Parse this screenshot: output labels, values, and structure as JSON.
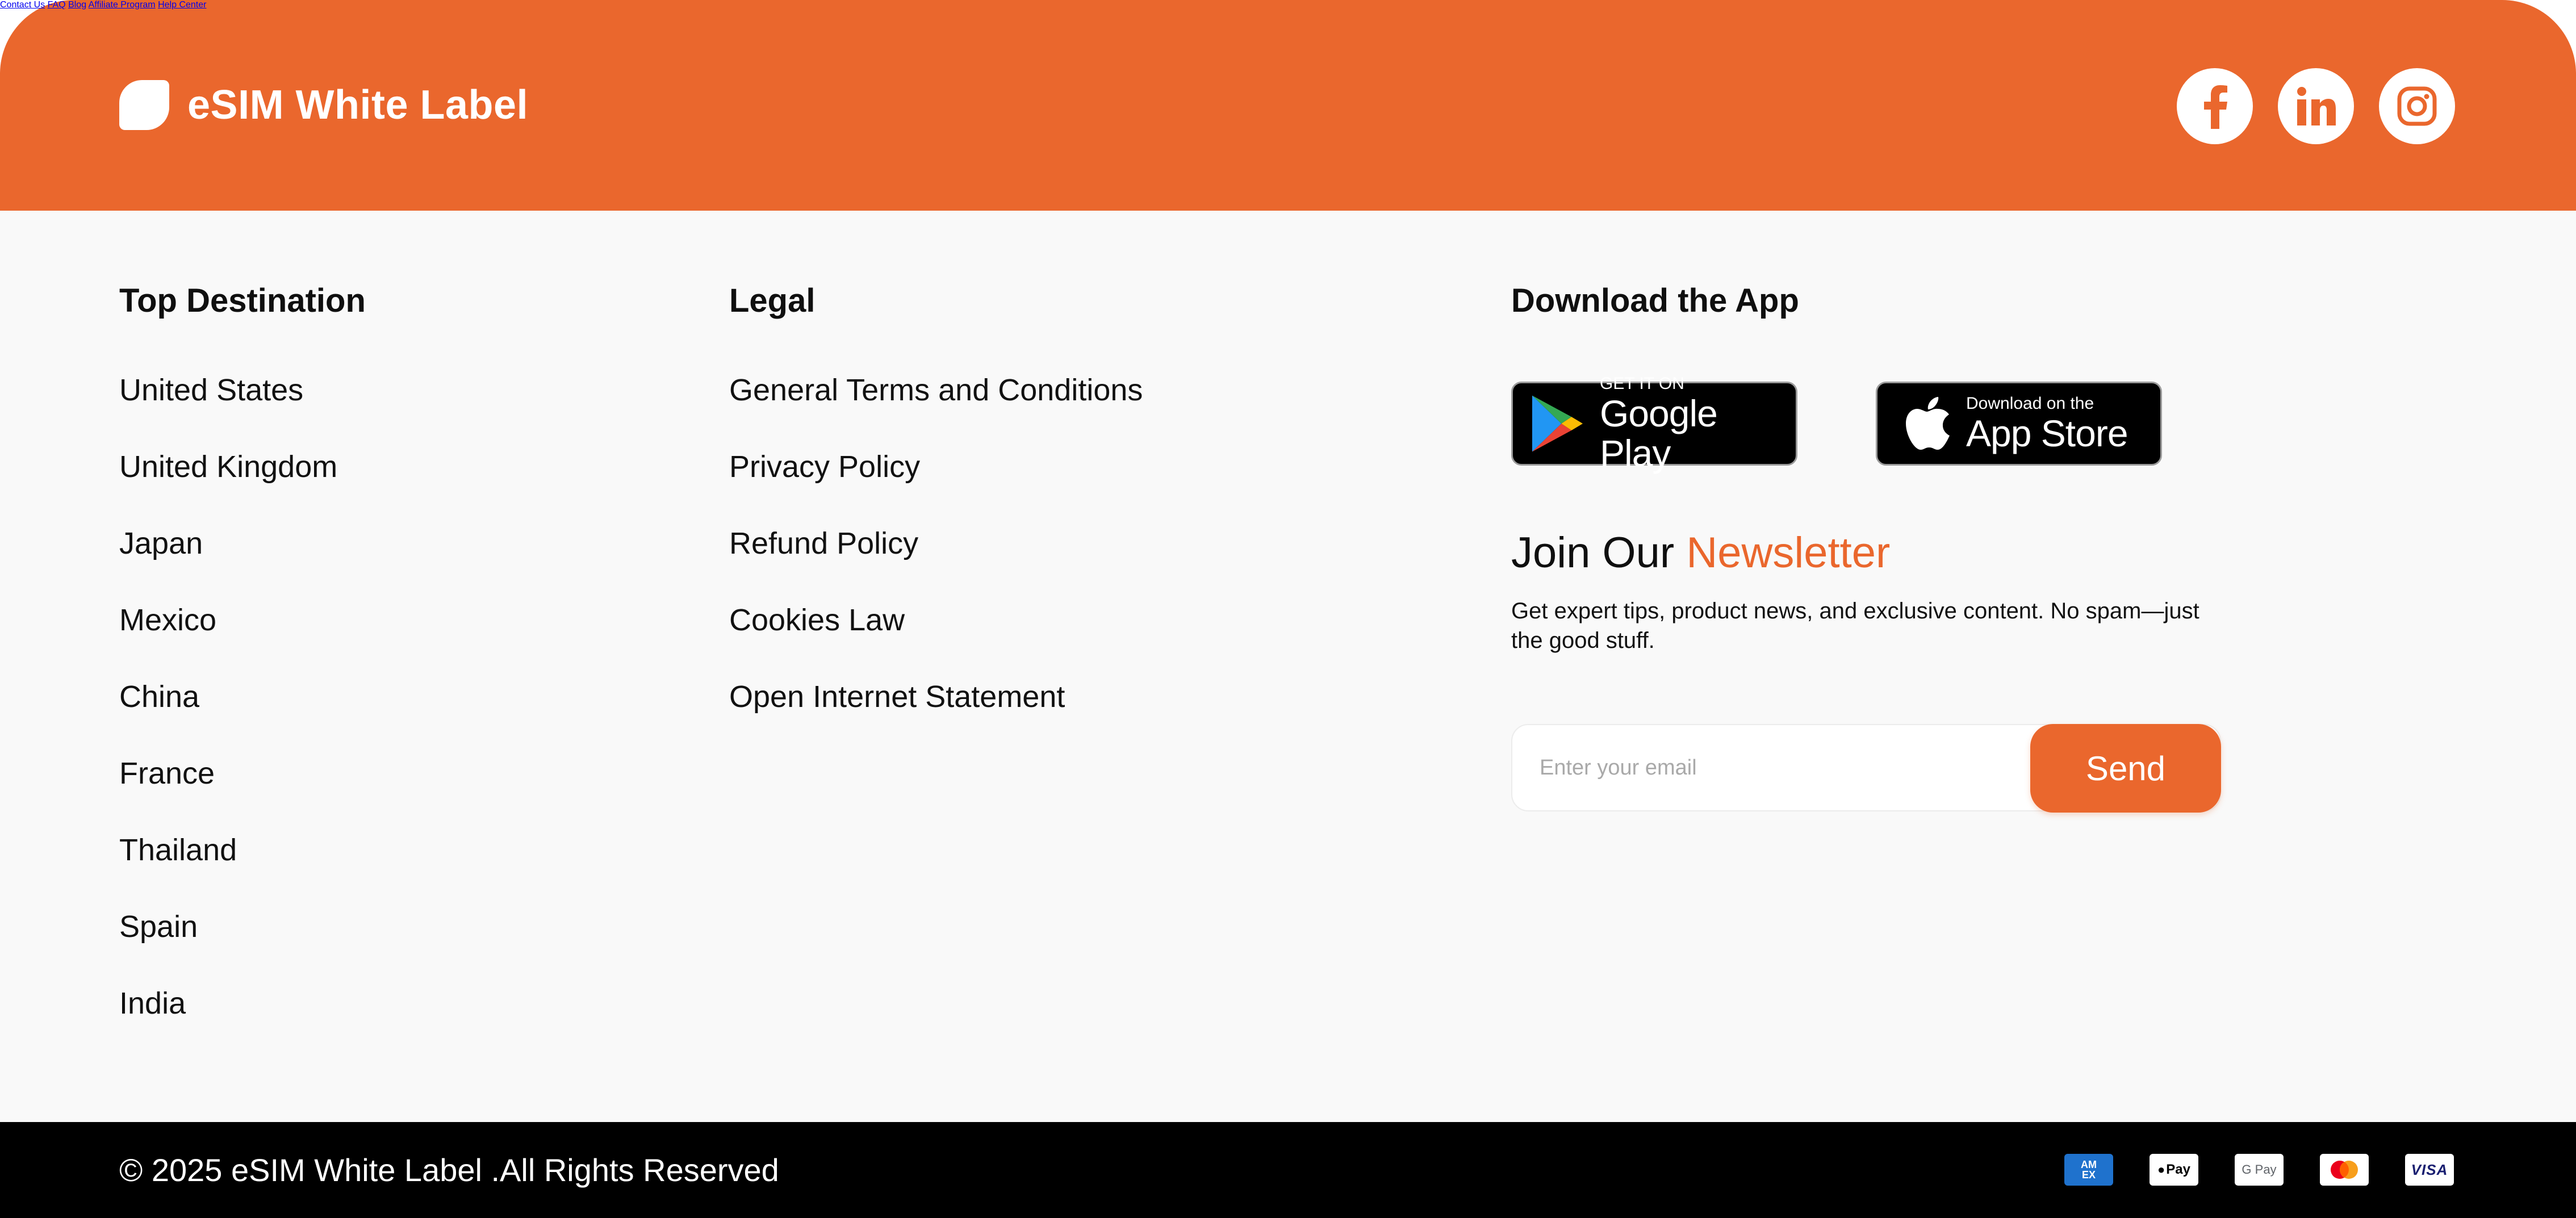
{
  "brand": {
    "name": "eSIM White Label",
    "logo_icon": "leaf-icon"
  },
  "nav": {
    "items": [
      "Contact Us",
      "FAQ",
      "Blog",
      "Affiliate Program",
      "Help Center"
    ]
  },
  "social": [
    {
      "name": "facebook-icon",
      "glyph": "f"
    },
    {
      "name": "linkedin-icon",
      "glyph": "in"
    },
    {
      "name": "instagram-icon",
      "glyph": ""
    }
  ],
  "destinations": {
    "title": "Top Destination",
    "items": [
      "United States",
      "United Kingdom",
      "Japan",
      "Mexico",
      "China",
      "France",
      "Thailand",
      "Spain",
      "India"
    ]
  },
  "legal": {
    "title": "Legal",
    "items": [
      "General Terms and Conditions",
      "Privacy Policy",
      "Refund Policy",
      "Cookies Law",
      "Open Internet Statement"
    ]
  },
  "app": {
    "title": "Download the App",
    "google": {
      "small": "GET IT ON",
      "big": "Google Play"
    },
    "apple": {
      "small": "Download on the",
      "big": "App Store"
    }
  },
  "newsletter": {
    "title_prefix": "Join Our",
    "title_accent": "Newsletter",
    "description": "Get expert tips, product news, and exclusive content. No spam—just the good stuff.",
    "placeholder": "Enter your email",
    "button": "Send"
  },
  "footer": {
    "copyright": "© 2025 eSIM White Label .All Rights Reserved",
    "payments": [
      {
        "name": "amex-icon",
        "label": "AM EX"
      },
      {
        "name": "apple-pay-icon",
        "label": "Pay"
      },
      {
        "name": "google-pay-icon",
        "label": "G Pay"
      },
      {
        "name": "mastercard-icon",
        "label": ""
      },
      {
        "name": "visa-icon",
        "label": "VISA"
      }
    ]
  },
  "colors": {
    "accent": "#EA672D",
    "background": "#F9F9F9",
    "footer": "#000000"
  }
}
